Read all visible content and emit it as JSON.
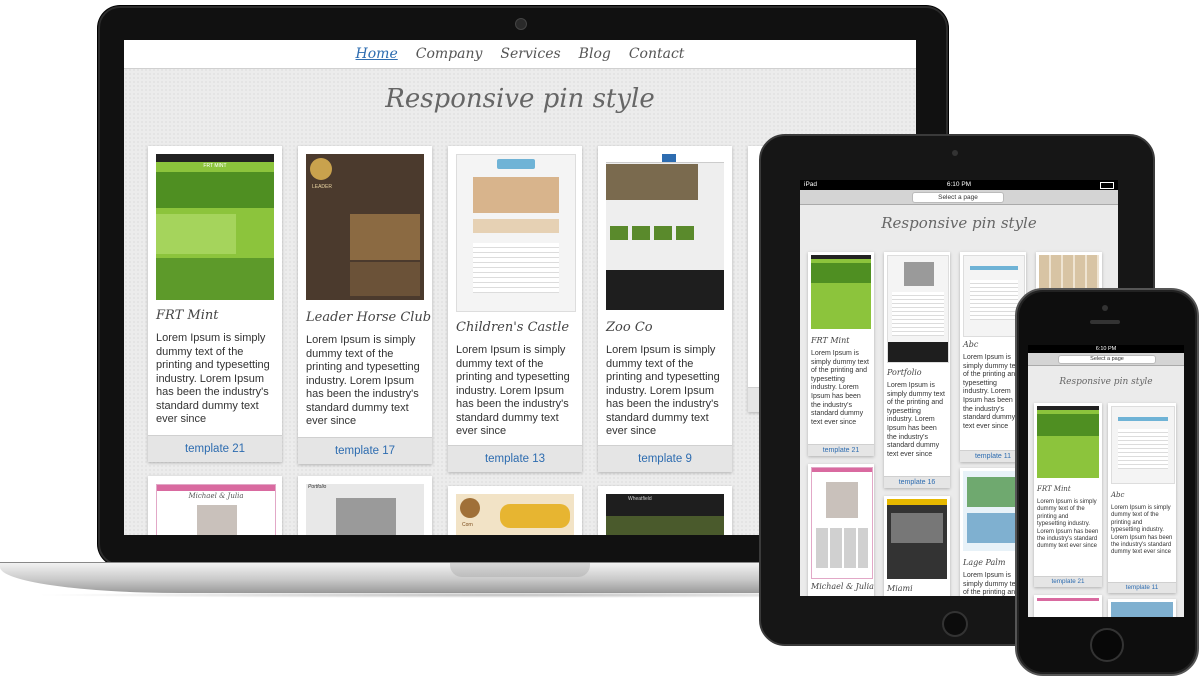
{
  "nav": {
    "items": [
      "Home",
      "Company",
      "Services",
      "Blog",
      "Contact"
    ]
  },
  "page_title": "Responsive pin style",
  "lorem": "Lorem Ipsum is simply dummy text of the printing and typesetting industry. Lorem Ipsum has been the industry's standard dummy text ever since",
  "pins": [
    {
      "title": "FRT Mint",
      "button": "template 21",
      "thumb_caption": "FRT MINT"
    },
    {
      "title": "Leader Horse Club",
      "button": "template 17",
      "thumb_caption": "LEADER"
    },
    {
      "title": "Children's Castle",
      "button": "template 13"
    },
    {
      "title": "Zoo Co",
      "button": "template 9"
    }
  ],
  "row2": [
    {
      "thumb_caption": "Michael & Julia"
    },
    {
      "thumb_caption": "Portfolio"
    },
    {
      "thumb_caption": "Corn"
    },
    {
      "thumb_caption": "Wheatfield"
    }
  ],
  "ipad": {
    "device": "iPad",
    "time": "6:10 PM",
    "select": "Select a page",
    "title": "Responsive pin style",
    "pins": [
      {
        "title": "FRT Mint",
        "button": "template 21"
      },
      {
        "title": "Portfolio",
        "button": "template 16"
      },
      {
        "title": "Abc",
        "button": "template 11"
      }
    ],
    "row2": [
      {
        "title": "Michael & Julia"
      },
      {
        "title": "Miami"
      },
      {
        "title": "Lage Palm"
      }
    ]
  },
  "iphone": {
    "time": "6:10 PM",
    "select": "Select a page",
    "title": "Responsive pin style",
    "pins": [
      {
        "title": "FRT Mint",
        "button": "template 21"
      },
      {
        "title": "Abc",
        "button": "template 11"
      }
    ]
  },
  "colors": {
    "accent": "#2d6cb0",
    "green": "#8cc43c",
    "dark": "#161616"
  }
}
